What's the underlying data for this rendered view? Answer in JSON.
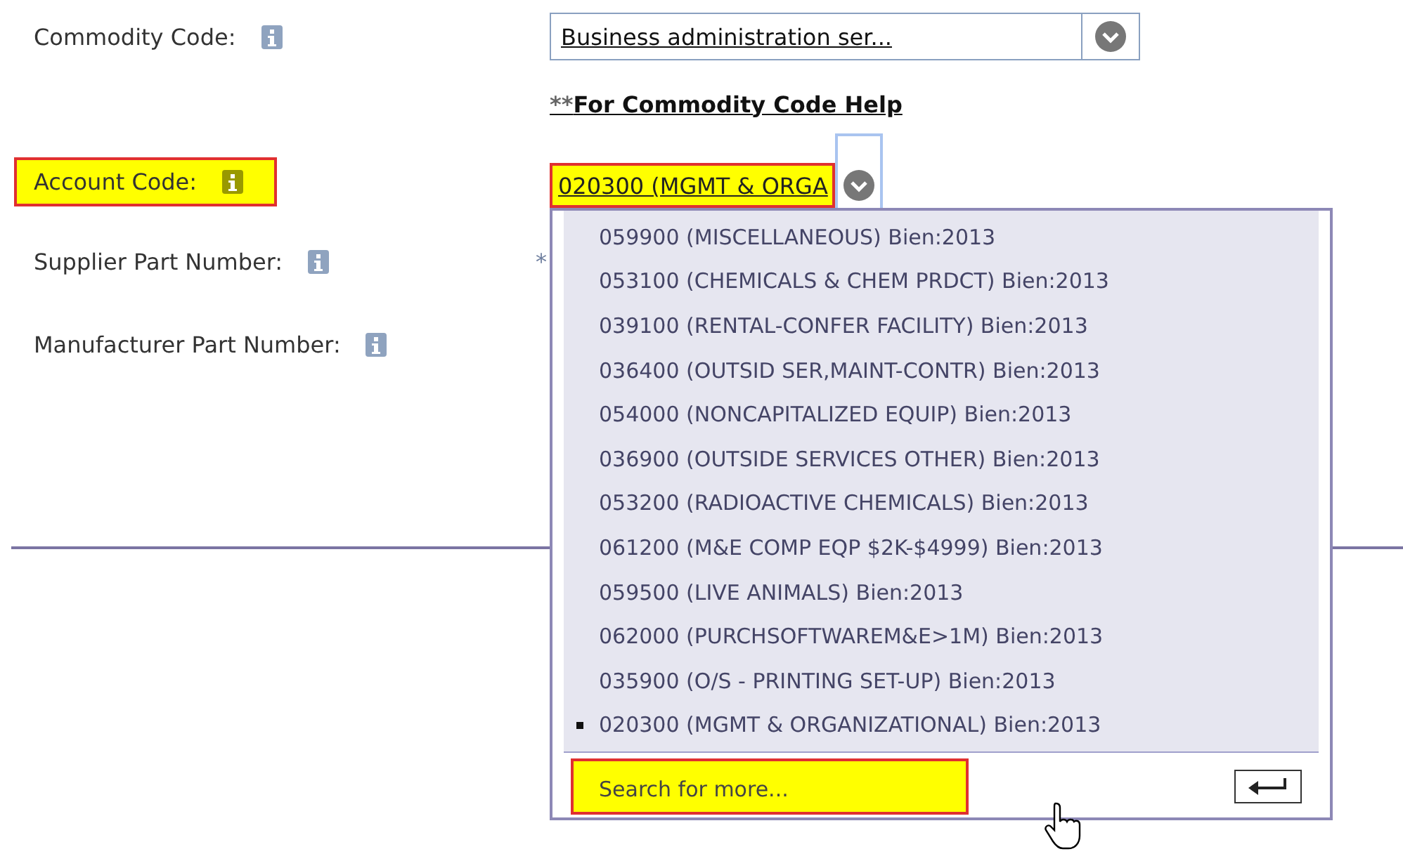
{
  "fields": [
    {
      "label": "Commodity Code:",
      "highlighted": false,
      "kind": "select",
      "value": "Business administration ser..."
    },
    {
      "kind": "link",
      "value": "For Commodity Code Help",
      "prefix": "**"
    },
    {
      "label": "Account Code:",
      "highlighted": true,
      "kind": "combo",
      "value": "020300 (MGMT & ORGA",
      "value_highlighted": true
    },
    {
      "label": "Supplier Part Number:",
      "highlighted": false,
      "kind": "required",
      "value": "*"
    },
    {
      "label": "Manufacturer Part Number:",
      "highlighted": false,
      "kind": "blank"
    }
  ],
  "dropdown": {
    "items": [
      {
        "text": "059900 (MISCELLANEOUS) Bien:2013",
        "selected": false
      },
      {
        "text": "053100 (CHEMICALS & CHEM PRDCT) Bien:2013",
        "selected": false
      },
      {
        "text": "039100 (RENTAL-CONFER FACILITY) Bien:2013",
        "selected": false
      },
      {
        "text": "036400 (OUTSID SER,MAINT-CONTR) Bien:2013",
        "selected": false
      },
      {
        "text": "054000 (NONCAPITALIZED EQUIP) Bien:2013",
        "selected": false
      },
      {
        "text": "036900 (OUTSIDE SERVICES OTHER) Bien:2013",
        "selected": false
      },
      {
        "text": "053200 (RADIOACTIVE CHEMICALS) Bien:2013",
        "selected": false
      },
      {
        "text": "061200 (M&E COMP EQP $2K-$4999) Bien:2013",
        "selected": false
      },
      {
        "text": "059500 (LIVE ANIMALS) Bien:2013",
        "selected": false
      },
      {
        "text": "062000 (PURCHSOFTWAREM&E>1M) Bien:2013",
        "selected": false
      },
      {
        "text": "035900 (O/S - PRINTING SET-UP) Bien:2013",
        "selected": false
      },
      {
        "text": "020300 (MGMT & ORGANIZATIONAL) Bien:2013",
        "selected": true
      }
    ],
    "search": {
      "text": "Search for more...",
      "highlighted": true
    }
  }
}
